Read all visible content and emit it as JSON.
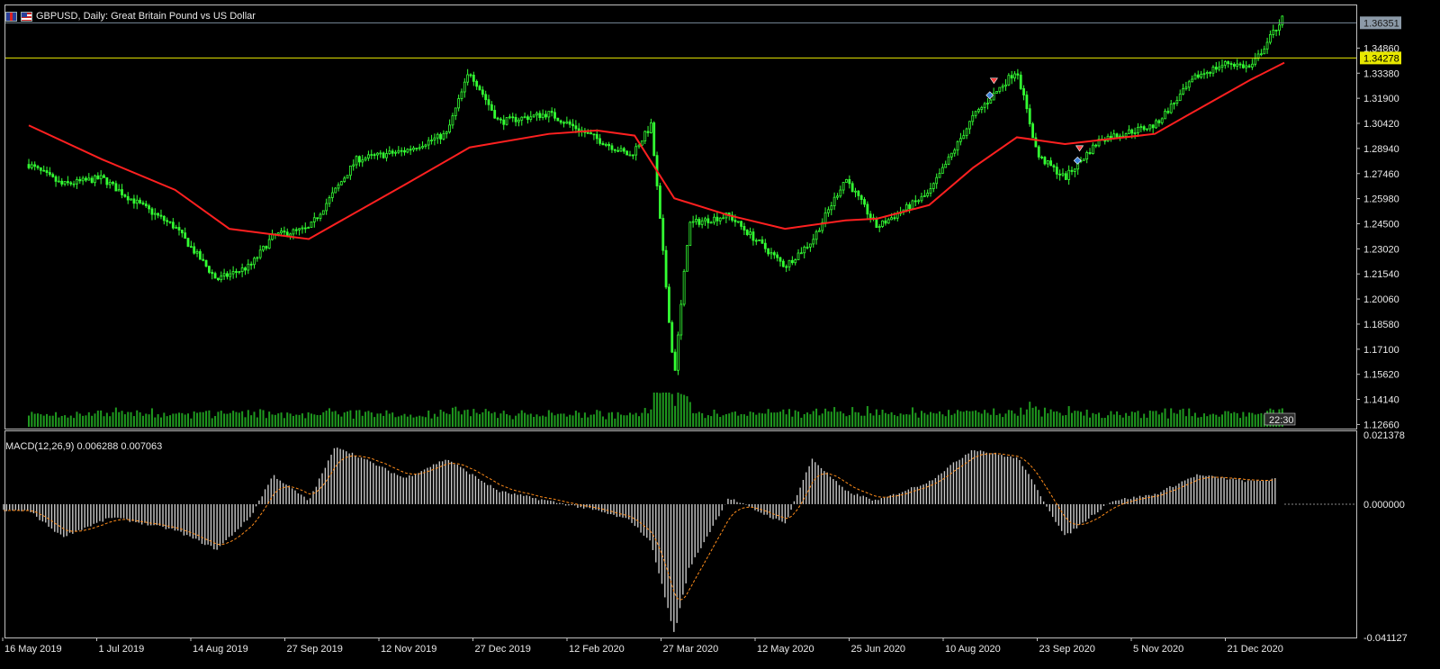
{
  "header": {
    "symbol_title": "GBPUSD, Daily:  Great Britain Pound vs US Dollar",
    "flag_left_icon": "gb-flag-icon",
    "flag_right_icon": "us-flag-icon"
  },
  "colors": {
    "background": "#000000",
    "bull_candle": "#33ff33",
    "ma_line": "#ff2020",
    "volume_bar": "#1f9a1f",
    "horizontal_level": "#e8e800",
    "macd_hist": "#c8c8c8",
    "macd_signal": "#ff8c1a",
    "axis_text": "#e8e8e8"
  },
  "price_labels": {
    "current_bid": "1.36351",
    "horizontal_level": "1.34278"
  },
  "timer_label": "22:30",
  "macd": {
    "label": "MACD(12,26,9) 0.006288 0.007063"
  },
  "chart_data": [
    {
      "type": "candlestick",
      "title": "GBPUSD, Daily:  Great Britain Pound vs US Dollar",
      "ylim": [
        1.1194,
        1.3759
      ],
      "price_axis_ticks": [
        "1.34860",
        "1.33380",
        "1.31900",
        "1.30420",
        "1.28940",
        "1.27460",
        "1.25980",
        "1.24500",
        "1.23020",
        "1.21540",
        "1.20060",
        "1.18580",
        "1.17100",
        "1.15620",
        "1.14140",
        "1.12660"
      ],
      "x_axis_labels": [
        "16 May 2019",
        "1 Jul 2019",
        "14 Aug 2019",
        "27 Sep 2019",
        "12 Nov 2019",
        "27 Dec 2019",
        "12 Feb 2020",
        "27 Mar 2020",
        "12 May 2020",
        "25 Jun 2020",
        "10 Aug 2020",
        "23 Sep 2020",
        "5 Nov 2020",
        "21 Dec 2020"
      ],
      "grid": false,
      "close_path": {
        "x": [
          "2019-05-16",
          "2019-06-01",
          "2019-06-20",
          "2019-07-01",
          "2019-07-25",
          "2019-08-14",
          "2019-08-30",
          "2019-09-10",
          "2019-09-27",
          "2019-10-20",
          "2019-11-12",
          "2019-12-02",
          "2019-12-13",
          "2019-12-27",
          "2020-01-20",
          "2020-02-12",
          "2020-02-28",
          "2020-03-09",
          "2020-03-20",
          "2020-03-27",
          "2020-04-15",
          "2020-05-12",
          "2020-05-25",
          "2020-06-10",
          "2020-06-25",
          "2020-07-20",
          "2020-08-10",
          "2020-08-31",
          "2020-09-10",
          "2020-09-23",
          "2020-10-10",
          "2020-11-05",
          "2020-11-25",
          "2020-12-10",
          "2020-12-21",
          "2021-01-06"
        ],
        "close": [
          1.28,
          1.268,
          1.272,
          1.262,
          1.243,
          1.212,
          1.22,
          1.238,
          1.242,
          1.283,
          1.288,
          1.298,
          1.335,
          1.305,
          1.31,
          1.295,
          1.285,
          1.303,
          1.155,
          1.245,
          1.25,
          1.22,
          1.235,
          1.272,
          1.243,
          1.263,
          1.308,
          1.336,
          1.285,
          1.272,
          1.295,
          1.303,
          1.332,
          1.34,
          1.337,
          1.368
        ]
      },
      "ma_line": {
        "x": [
          "2019-05-16",
          "2019-06-20",
          "2019-07-25",
          "2019-08-20",
          "2019-09-27",
          "2019-11-12",
          "2019-12-13",
          "2020-01-20",
          "2020-02-12",
          "2020-03-01",
          "2020-03-20",
          "2020-04-15",
          "2020-05-12",
          "2020-06-10",
          "2020-06-25",
          "2020-07-20",
          "2020-08-10",
          "2020-08-31",
          "2020-09-23",
          "2020-11-05",
          "2020-11-25",
          "2020-12-21",
          "2021-01-06"
        ],
        "value": [
          1.303,
          1.283,
          1.265,
          1.242,
          1.236,
          1.268,
          1.29,
          1.298,
          1.3,
          1.297,
          1.26,
          1.25,
          1.242,
          1.247,
          1.248,
          1.256,
          1.278,
          1.296,
          1.292,
          1.298,
          1.312,
          1.33,
          1.34
        ]
      },
      "horizontal_level": 1.34278,
      "current_bid": 1.36351,
      "trade_markers": [
        {
          "x": "2020-08-20",
          "side": "sell"
        },
        {
          "x": "2020-08-18",
          "side": "buy"
        },
        {
          "x": "2020-09-30",
          "side": "sell"
        },
        {
          "x": "2020-09-29",
          "side": "buy"
        }
      ]
    },
    {
      "type": "bar",
      "title": "MACD(12,26,9) 0.006288 0.007063",
      "ylim": [
        -0.041127,
        0.021378
      ],
      "axis_ticks": [
        "0.021378",
        "0.000000",
        "-0.041127"
      ],
      "main_value": 0.006288,
      "signal_value": 0.007063,
      "macd_path": {
        "x": [
          "2019-05-16",
          "2019-06-01",
          "2019-06-25",
          "2019-07-25",
          "2019-08-14",
          "2019-08-30",
          "2019-09-10",
          "2019-09-27",
          "2019-10-10",
          "2019-11-12",
          "2019-12-02",
          "2019-12-27",
          "2020-01-20",
          "2020-02-12",
          "2020-02-28",
          "2020-03-09",
          "2020-03-20",
          "2020-03-27",
          "2020-04-15",
          "2020-05-12",
          "2020-05-25",
          "2020-06-10",
          "2020-06-25",
          "2020-07-20",
          "2020-08-10",
          "2020-09-01",
          "2020-09-23",
          "2020-10-15",
          "2020-11-05",
          "2020-11-25",
          "2020-12-21",
          "2021-01-06"
        ],
        "value": [
          -0.002,
          -0.01,
          -0.004,
          -0.008,
          -0.014,
          -0.004,
          0.009,
          0.001,
          0.018,
          0.008,
          0.014,
          0.004,
          0.001,
          -0.002,
          -0.005,
          -0.012,
          -0.04,
          -0.02,
          0.002,
          -0.006,
          0.014,
          0.004,
          0.001,
          0.007,
          0.017,
          0.014,
          -0.01,
          0.001,
          0.003,
          0.009,
          0.007,
          0.008
        ]
      }
    }
  ]
}
